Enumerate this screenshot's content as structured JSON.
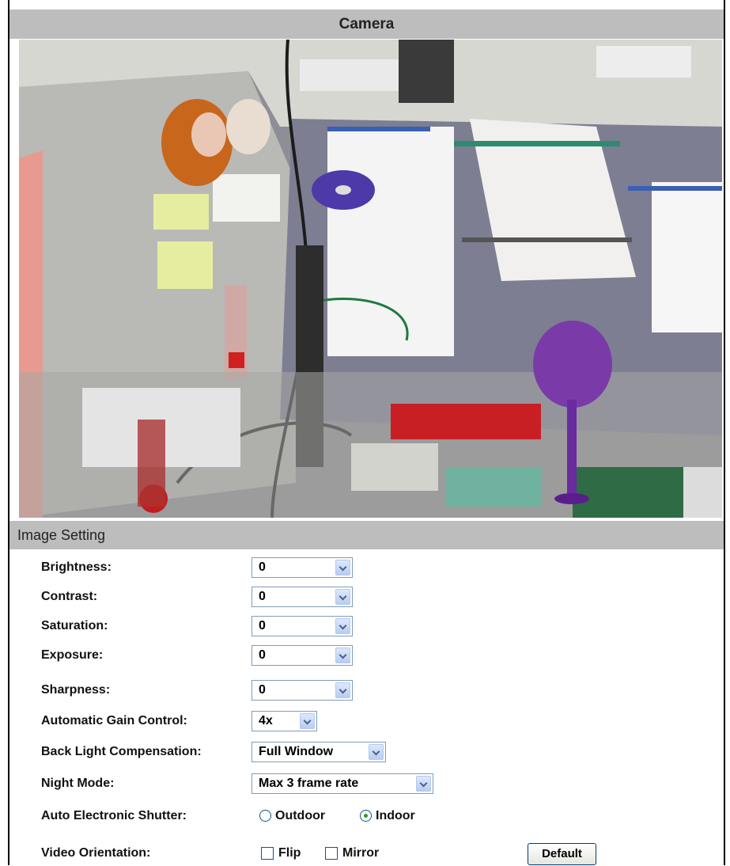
{
  "header": {
    "title": "Camera"
  },
  "image_setting": {
    "section_title": "Image Setting",
    "brightness": {
      "label": "Brightness:",
      "value": "0"
    },
    "contrast": {
      "label": "Contrast:",
      "value": "0"
    },
    "saturation": {
      "label": "Saturation:",
      "value": "0"
    },
    "exposure": {
      "label": "Exposure:",
      "value": "0"
    },
    "sharpness": {
      "label": "Sharpness:",
      "value": "0"
    },
    "agc": {
      "label": "Automatic Gain Control:",
      "value": "4x"
    },
    "blc": {
      "label": "Back Light Compensation:",
      "value": "Full Window"
    },
    "night_mode": {
      "label": "Night Mode:",
      "value": "Max 3 frame rate"
    },
    "shutter": {
      "label": "Auto Electronic Shutter:",
      "options": [
        "Outdoor",
        "Indoor"
      ],
      "selected": "Indoor"
    },
    "orientation": {
      "label": "Video Orientation:",
      "flip_label": "Flip",
      "flip_checked": false,
      "mirror_label": "Mirror",
      "mirror_checked": false
    },
    "default_button": "Default"
  }
}
